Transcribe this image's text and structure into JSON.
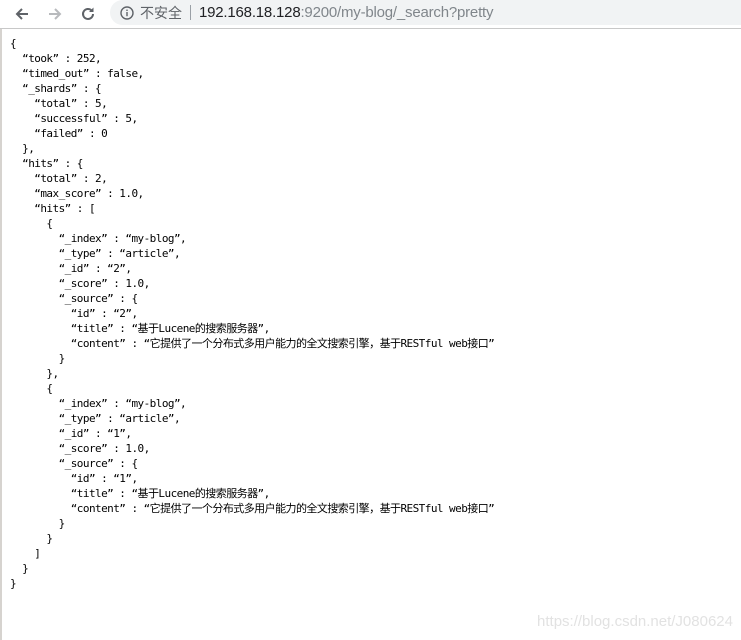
{
  "browser": {
    "security_label": "不安全",
    "url_host": "192.168.18.128",
    "url_rest": ":9200/my-blog/_search?pretty"
  },
  "response": {
    "took": 252,
    "timed_out": false,
    "_shards": {
      "total": 5,
      "successful": 5,
      "failed": 0
    },
    "hits": {
      "total": 2,
      "max_score": "1.0",
      "hits": [
        {
          "_index": "my-blog",
          "_type": "article",
          "_id": "2",
          "_score": "1.0",
          "_source": {
            "id": "2",
            "title": "基于Lucene的搜索服务器",
            "content": "它提供了一个分布式多用户能力的全文搜索引擎，基于RESTful web接口"
          }
        },
        {
          "_index": "my-blog",
          "_type": "article",
          "_id": "1",
          "_score": "1.0",
          "_source": {
            "id": "1",
            "title": "基于Lucene的搜索服务器",
            "content": "它提供了一个分布式多用户能力的全文搜索引擎，基于RESTful web接口"
          }
        }
      ]
    }
  },
  "watermark": "https://blog.csdn.net/J080624"
}
